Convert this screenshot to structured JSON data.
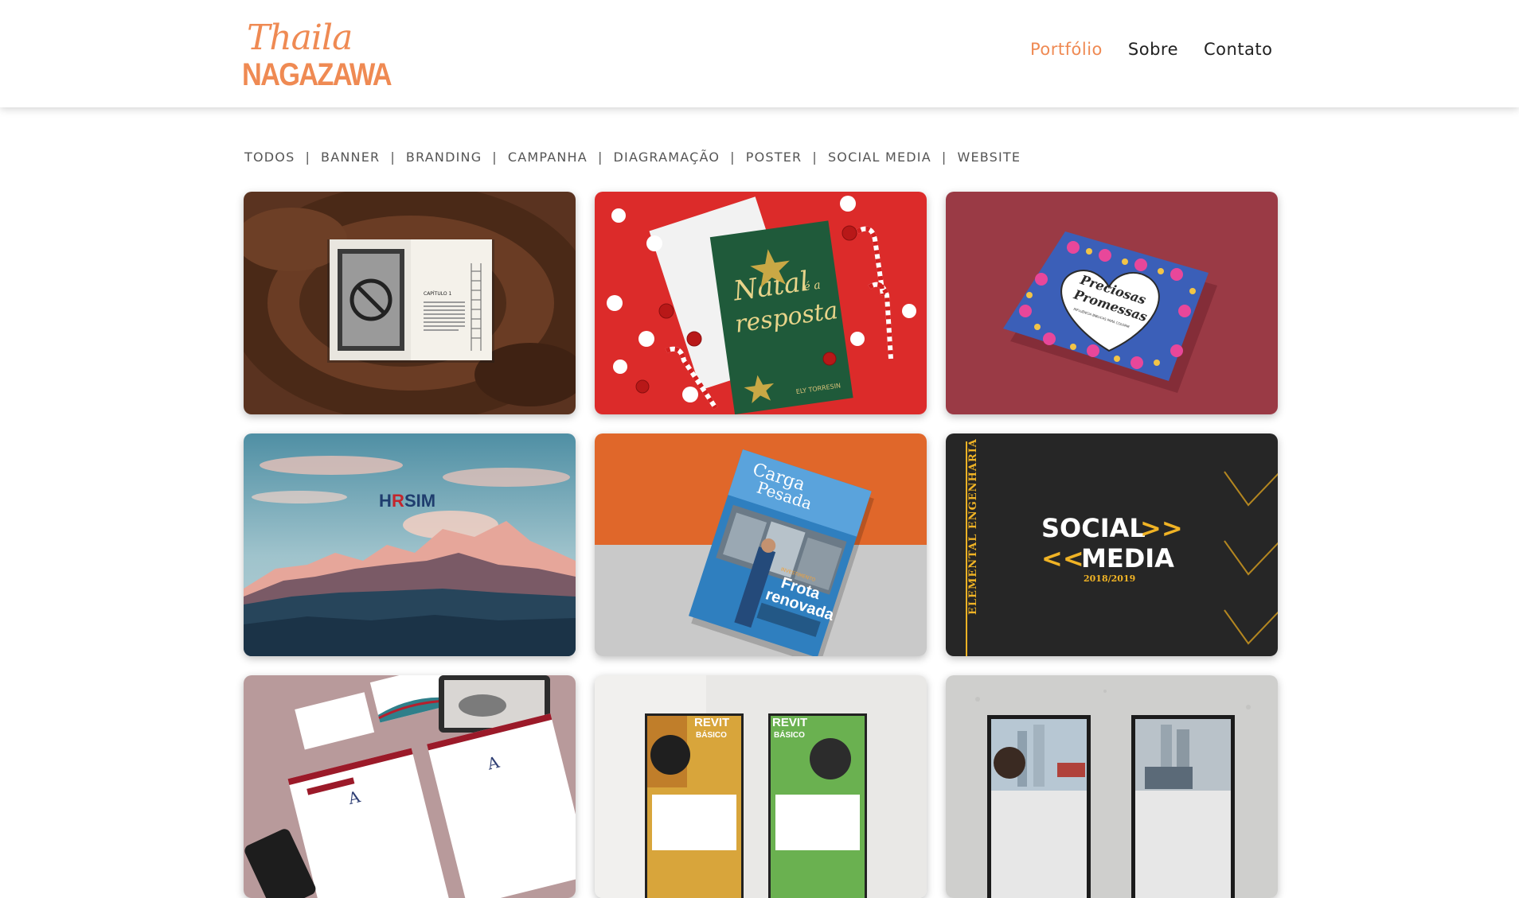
{
  "logo": {
    "script": "Thaila",
    "block": "NAGAZAWA"
  },
  "nav": {
    "items": [
      "Portfólio",
      "Sobre",
      "Contato"
    ],
    "active": "Portfólio",
    "accent": "#ef8a53"
  },
  "filters": [
    "TODOS",
    "BANNER",
    "BRANDING",
    "CAMPANHA",
    "DIAGRAMAÇÃO",
    "POSTER",
    "SOCIAL MEDIA",
    "WEBSITE"
  ],
  "cards": {
    "c1": {
      "chapter": "CAPÍTULO 1"
    },
    "c2": {
      "title1": "Natal",
      "title_mid": "é a",
      "title2": "resposta",
      "author": "ELY TORRESIN"
    },
    "c3": {
      "title1": "Preciosas",
      "title2": "Promessas",
      "subtitle": "INFLUÊNCIA BÍBLICAS PARA COLORIR"
    },
    "c4": {
      "brand_a": "H",
      "brand_b": "R",
      "brand_c": "SIM"
    },
    "c5": {
      "mag1": "Carga",
      "mag2": "Pesada",
      "headline1": "Frota",
      "headline2": "renovada",
      "kicker": "INVESTIMENTO"
    },
    "c6": {
      "side": "ELEMENTAL ENGENHARIA",
      "line1": "SOCIAL",
      "line2": "MEDIA",
      "arrows1": ">>",
      "arrows2": "<<",
      "years": "2018/2019"
    },
    "c7": {},
    "c8": {
      "poster": "REVIT",
      "poster_sub": "BÁSICO"
    },
    "c9": {}
  }
}
